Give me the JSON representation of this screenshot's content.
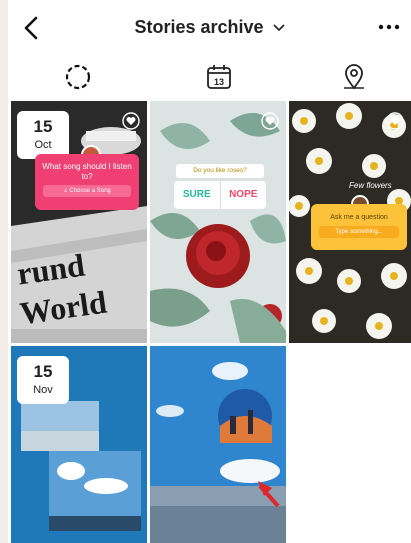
{
  "header": {
    "title": "Stories archive",
    "back_icon": "chevron-left-icon",
    "dropdown_icon": "chevron-down-icon",
    "more_icon": "more-horizontal-icon"
  },
  "tabs": [
    {
      "name": "stories",
      "icon": "story-ring-icon",
      "selected": true
    },
    {
      "name": "calendar",
      "icon": "calendar-icon",
      "day": "13"
    },
    {
      "name": "map",
      "icon": "map-pin-icon"
    }
  ],
  "stories": [
    {
      "date_day": "15",
      "date_month": "Oct",
      "sticker_question": "What song should I listen to?",
      "sticker_button": "Choose a Song",
      "colors": {
        "sticker": "#ef3f73"
      }
    },
    {
      "poll_question": "Do you like roses?",
      "poll_options": [
        "SURE",
        "NOPE"
      ]
    },
    {
      "caption": "Few flowers",
      "sticker_question": "Ask me a question",
      "sticker_button": "Type something..."
    },
    {
      "date_day": "15",
      "date_month": "Nov"
    },
    {}
  ],
  "colors": {
    "accent_arrow": "#e0262b"
  }
}
